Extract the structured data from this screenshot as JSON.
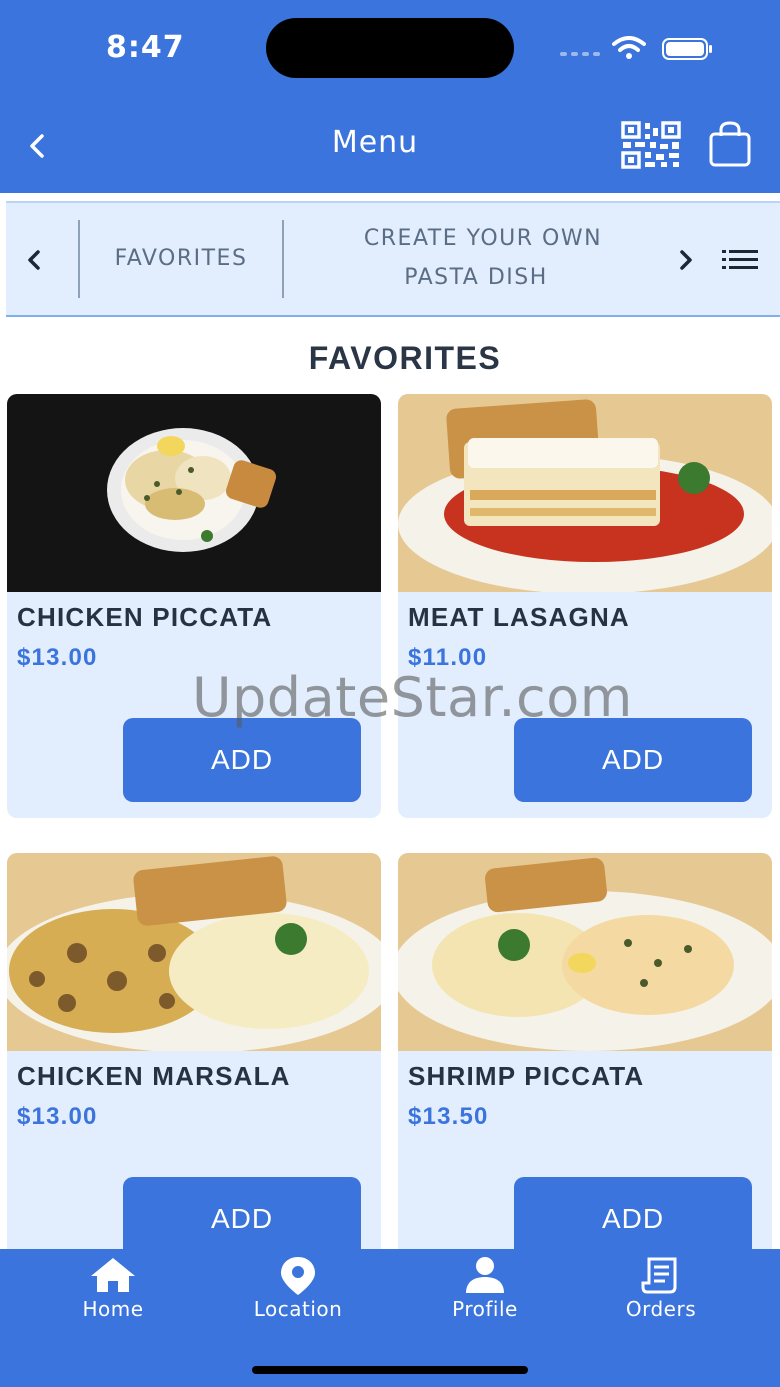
{
  "status_bar": {
    "time": "8:47"
  },
  "nav": {
    "title": "Menu",
    "icons": [
      "back-icon",
      "qr-code-icon",
      "shopping-bag-icon"
    ]
  },
  "categories": {
    "items": [
      {
        "label": "FAVORITES"
      },
      {
        "line1": "CREATE YOUR OWN",
        "line2": "PASTA DISH"
      }
    ],
    "icons": [
      "chevron-left-icon",
      "chevron-right-icon",
      "list-icon"
    ]
  },
  "section": {
    "title": "FAVORITES"
  },
  "products": [
    {
      "name": "CHICKEN PICCATA",
      "price": "$13.00",
      "add_label": "ADD"
    },
    {
      "name": "MEAT LASAGNA",
      "price": "$11.00",
      "add_label": "ADD"
    },
    {
      "name": "CHICKEN MARSALA",
      "price": "$13.00",
      "add_label": "ADD"
    },
    {
      "name": "SHRIMP PICCATA",
      "price": "$13.50",
      "add_label": "ADD"
    }
  ],
  "watermark": "UpdateStar.com",
  "tabs": [
    {
      "label": "Home",
      "icon": "home-icon"
    },
    {
      "label": "Location",
      "icon": "location-pin-icon"
    },
    {
      "label": "Profile",
      "icon": "person-icon"
    },
    {
      "label": "Orders",
      "icon": "receipt-icon"
    }
  ],
  "colors": {
    "primary": "#3a74dc",
    "card_bg": "#e2eefe",
    "text_dark": "#263242",
    "category_text": "#5b6d84"
  }
}
